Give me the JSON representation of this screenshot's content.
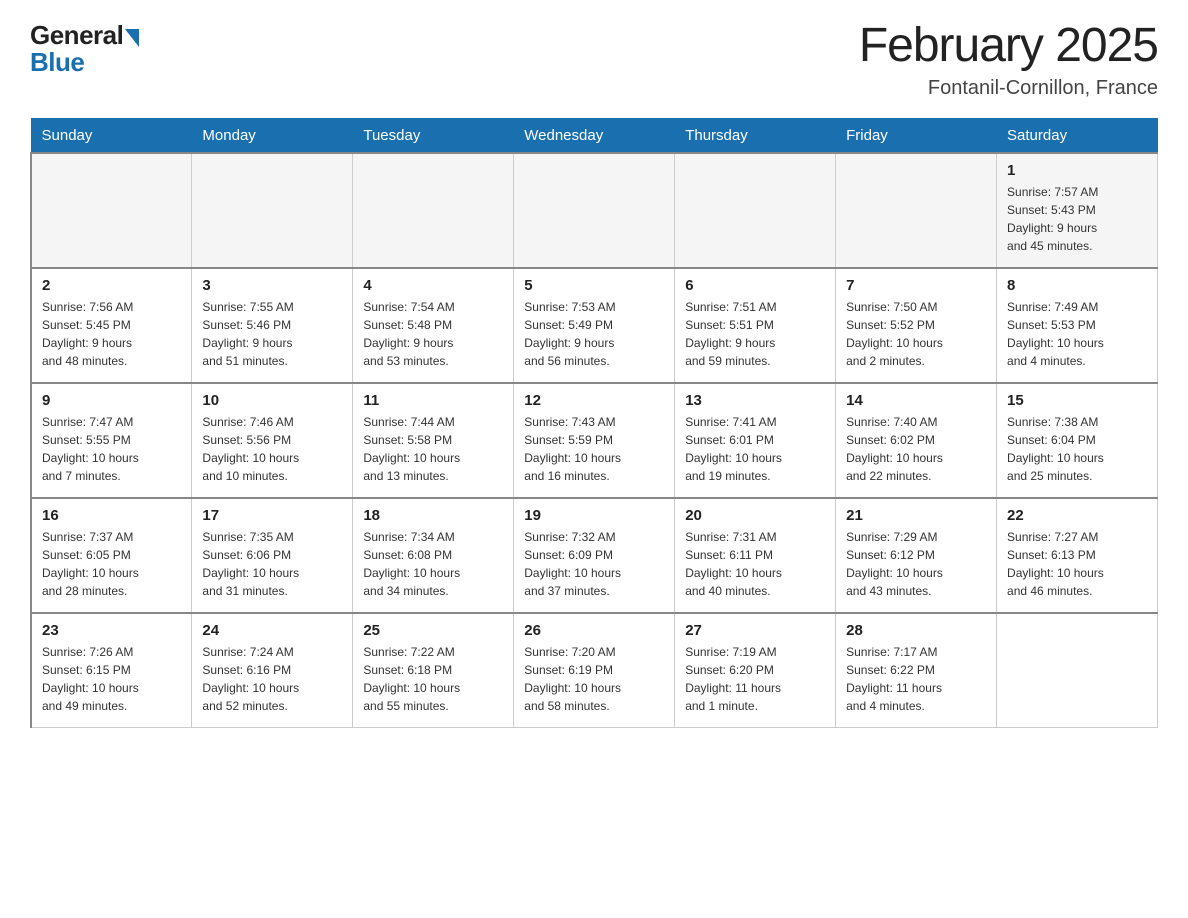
{
  "logo": {
    "general": "General",
    "blue": "Blue"
  },
  "header": {
    "title": "February 2025",
    "location": "Fontanil-Cornillon, France"
  },
  "days_of_week": [
    "Sunday",
    "Monday",
    "Tuesday",
    "Wednesday",
    "Thursday",
    "Friday",
    "Saturday"
  ],
  "weeks": [
    [
      {
        "day": "",
        "info": ""
      },
      {
        "day": "",
        "info": ""
      },
      {
        "day": "",
        "info": ""
      },
      {
        "day": "",
        "info": ""
      },
      {
        "day": "",
        "info": ""
      },
      {
        "day": "",
        "info": ""
      },
      {
        "day": "1",
        "info": "Sunrise: 7:57 AM\nSunset: 5:43 PM\nDaylight: 9 hours\nand 45 minutes."
      }
    ],
    [
      {
        "day": "2",
        "info": "Sunrise: 7:56 AM\nSunset: 5:45 PM\nDaylight: 9 hours\nand 48 minutes."
      },
      {
        "day": "3",
        "info": "Sunrise: 7:55 AM\nSunset: 5:46 PM\nDaylight: 9 hours\nand 51 minutes."
      },
      {
        "day": "4",
        "info": "Sunrise: 7:54 AM\nSunset: 5:48 PM\nDaylight: 9 hours\nand 53 minutes."
      },
      {
        "day": "5",
        "info": "Sunrise: 7:53 AM\nSunset: 5:49 PM\nDaylight: 9 hours\nand 56 minutes."
      },
      {
        "day": "6",
        "info": "Sunrise: 7:51 AM\nSunset: 5:51 PM\nDaylight: 9 hours\nand 59 minutes."
      },
      {
        "day": "7",
        "info": "Sunrise: 7:50 AM\nSunset: 5:52 PM\nDaylight: 10 hours\nand 2 minutes."
      },
      {
        "day": "8",
        "info": "Sunrise: 7:49 AM\nSunset: 5:53 PM\nDaylight: 10 hours\nand 4 minutes."
      }
    ],
    [
      {
        "day": "9",
        "info": "Sunrise: 7:47 AM\nSunset: 5:55 PM\nDaylight: 10 hours\nand 7 minutes."
      },
      {
        "day": "10",
        "info": "Sunrise: 7:46 AM\nSunset: 5:56 PM\nDaylight: 10 hours\nand 10 minutes."
      },
      {
        "day": "11",
        "info": "Sunrise: 7:44 AM\nSunset: 5:58 PM\nDaylight: 10 hours\nand 13 minutes."
      },
      {
        "day": "12",
        "info": "Sunrise: 7:43 AM\nSunset: 5:59 PM\nDaylight: 10 hours\nand 16 minutes."
      },
      {
        "day": "13",
        "info": "Sunrise: 7:41 AM\nSunset: 6:01 PM\nDaylight: 10 hours\nand 19 minutes."
      },
      {
        "day": "14",
        "info": "Sunrise: 7:40 AM\nSunset: 6:02 PM\nDaylight: 10 hours\nand 22 minutes."
      },
      {
        "day": "15",
        "info": "Sunrise: 7:38 AM\nSunset: 6:04 PM\nDaylight: 10 hours\nand 25 minutes."
      }
    ],
    [
      {
        "day": "16",
        "info": "Sunrise: 7:37 AM\nSunset: 6:05 PM\nDaylight: 10 hours\nand 28 minutes."
      },
      {
        "day": "17",
        "info": "Sunrise: 7:35 AM\nSunset: 6:06 PM\nDaylight: 10 hours\nand 31 minutes."
      },
      {
        "day": "18",
        "info": "Sunrise: 7:34 AM\nSunset: 6:08 PM\nDaylight: 10 hours\nand 34 minutes."
      },
      {
        "day": "19",
        "info": "Sunrise: 7:32 AM\nSunset: 6:09 PM\nDaylight: 10 hours\nand 37 minutes."
      },
      {
        "day": "20",
        "info": "Sunrise: 7:31 AM\nSunset: 6:11 PM\nDaylight: 10 hours\nand 40 minutes."
      },
      {
        "day": "21",
        "info": "Sunrise: 7:29 AM\nSunset: 6:12 PM\nDaylight: 10 hours\nand 43 minutes."
      },
      {
        "day": "22",
        "info": "Sunrise: 7:27 AM\nSunset: 6:13 PM\nDaylight: 10 hours\nand 46 minutes."
      }
    ],
    [
      {
        "day": "23",
        "info": "Sunrise: 7:26 AM\nSunset: 6:15 PM\nDaylight: 10 hours\nand 49 minutes."
      },
      {
        "day": "24",
        "info": "Sunrise: 7:24 AM\nSunset: 6:16 PM\nDaylight: 10 hours\nand 52 minutes."
      },
      {
        "day": "25",
        "info": "Sunrise: 7:22 AM\nSunset: 6:18 PM\nDaylight: 10 hours\nand 55 minutes."
      },
      {
        "day": "26",
        "info": "Sunrise: 7:20 AM\nSunset: 6:19 PM\nDaylight: 10 hours\nand 58 minutes."
      },
      {
        "day": "27",
        "info": "Sunrise: 7:19 AM\nSunset: 6:20 PM\nDaylight: 11 hours\nand 1 minute."
      },
      {
        "day": "28",
        "info": "Sunrise: 7:17 AM\nSunset: 6:22 PM\nDaylight: 11 hours\nand 4 minutes."
      },
      {
        "day": "",
        "info": ""
      }
    ]
  ]
}
